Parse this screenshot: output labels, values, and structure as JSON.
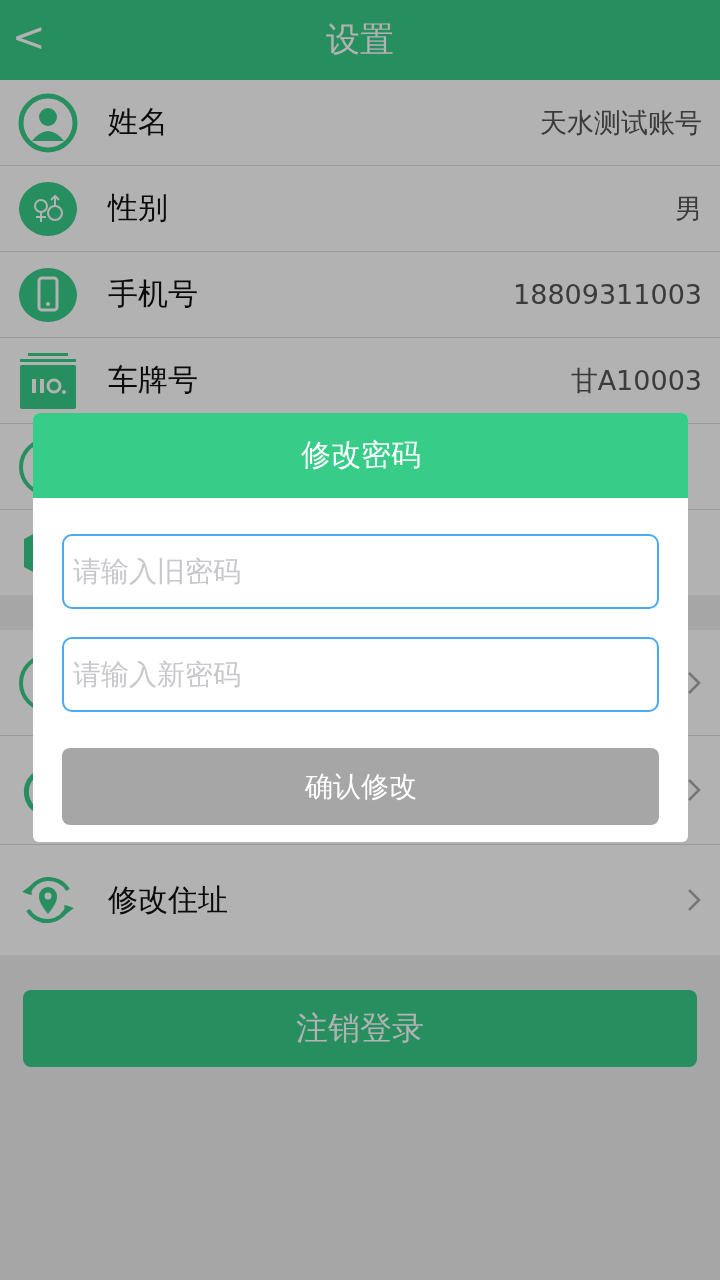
{
  "header": {
    "back": "<",
    "title": "设置"
  },
  "sections": [
    {
      "rows": [
        {
          "kind": "info",
          "label": "姓名",
          "value": "天水测试账号"
        },
        {
          "kind": "info",
          "label": "性别",
          "value": "男"
        },
        {
          "kind": "info",
          "label": "手机号",
          "value": "18809311003"
        },
        {
          "kind": "info",
          "label": "车牌号",
          "value": "甘A10003"
        },
        {
          "kind": "info"
        },
        {
          "kind": "info"
        }
      ]
    },
    {
      "rows": [
        {
          "kind": "link"
        },
        {
          "kind": "link"
        },
        {
          "kind": "link",
          "label": "修改住址"
        }
      ]
    }
  ],
  "logout": "注销登录",
  "dialog": {
    "title": "修改密码",
    "fields": [
      {
        "placeholder": "请输入旧密码"
      },
      {
        "placeholder": "请输入新密码"
      }
    ],
    "confirm": "确认修改"
  }
}
